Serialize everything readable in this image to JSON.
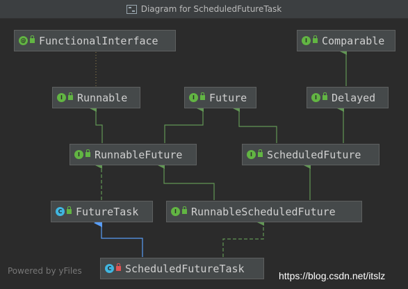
{
  "window": {
    "title": "Diagram for ScheduledFutureTask"
  },
  "colors": {
    "background": "#2b2b2b",
    "node_fill": "#45494a",
    "edge_green": "#629755",
    "edge_blue": "#589df6",
    "interface_icon": "#62b543",
    "class_icon": "#40b6e0"
  },
  "nodes": {
    "functional_interface": {
      "label": "FunctionalInterface",
      "kind": "annotation",
      "icon": "annotation-icon"
    },
    "comparable": {
      "label": "Comparable",
      "kind": "interface",
      "icon": "interface-icon"
    },
    "runnable": {
      "label": "Runnable",
      "kind": "interface",
      "icon": "interface-icon"
    },
    "future": {
      "label": "Future",
      "kind": "interface",
      "icon": "interface-icon"
    },
    "delayed": {
      "label": "Delayed",
      "kind": "interface",
      "icon": "interface-icon"
    },
    "runnable_future": {
      "label": "RunnableFuture",
      "kind": "interface",
      "icon": "interface-icon"
    },
    "scheduled_future": {
      "label": "ScheduledFuture",
      "kind": "interface",
      "icon": "interface-icon"
    },
    "future_task": {
      "label": "FutureTask",
      "kind": "class",
      "icon": "class-icon"
    },
    "runnable_scheduled_future": {
      "label": "RunnableScheduledFuture",
      "kind": "interface",
      "icon": "interface-icon"
    },
    "scheduled_future_task": {
      "label": "ScheduledFutureTask",
      "kind": "class",
      "icon": "class-icon",
      "access": "private"
    }
  },
  "edges": [
    {
      "from": "Runnable",
      "to": "FunctionalInterface",
      "type": "annotated"
    },
    {
      "from": "Delayed",
      "to": "Comparable",
      "type": "extends"
    },
    {
      "from": "RunnableFuture",
      "to": "Runnable",
      "type": "extends"
    },
    {
      "from": "RunnableFuture",
      "to": "Future",
      "type": "extends"
    },
    {
      "from": "ScheduledFuture",
      "to": "Future",
      "type": "extends"
    },
    {
      "from": "ScheduledFuture",
      "to": "Delayed",
      "type": "extends"
    },
    {
      "from": "FutureTask",
      "to": "RunnableFuture",
      "type": "implements"
    },
    {
      "from": "RunnableScheduledFuture",
      "to": "RunnableFuture",
      "type": "extends"
    },
    {
      "from": "RunnableScheduledFuture",
      "to": "ScheduledFuture",
      "type": "extends"
    },
    {
      "from": "ScheduledFutureTask",
      "to": "FutureTask",
      "type": "extends-class"
    },
    {
      "from": "ScheduledFutureTask",
      "to": "RunnableScheduledFuture",
      "type": "implements"
    }
  ],
  "footer": {
    "powered_by": "Powered by yFiles"
  },
  "watermark": {
    "text": "https://blog.csdn.net/itslz"
  }
}
